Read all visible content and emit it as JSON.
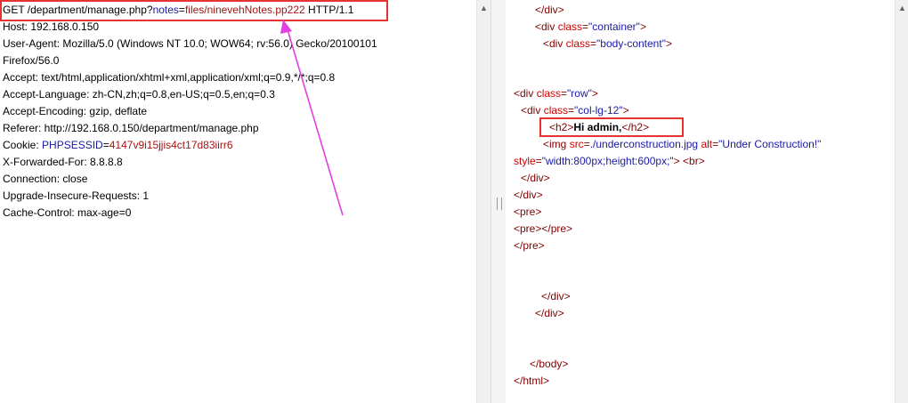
{
  "request": {
    "method": "GET",
    "path": "/department/manage.php?",
    "param_name": "notes",
    "eq": "=",
    "param_value": "files/ninevehNotes.pp222",
    "protocol": "HTTP/1.1",
    "host": "Host: 192.168.0.150",
    "ua_line1": "User-Agent: Mozilla/5.0 (Windows NT 10.0; WOW64; rv:56.0) Gecko/20100101",
    "ua_line2": "Firefox/56.0",
    "accept": "Accept: text/html,application/xhtml+xml,application/xml;q=0.9,*/*;q=0.8",
    "accept_language": "Accept-Language: zh-CN,zh;q=0.8,en-US;q=0.5,en;q=0.3",
    "accept_encoding": "Accept-Encoding: gzip, deflate",
    "referer": "Referer: http://192.168.0.150/department/manage.php",
    "cookie_label": "Cookie: ",
    "cookie_name": "PHPSESSID",
    "cookie_value": "4147v9i15jjis4ct17d83iirr6",
    "xff": "X-Forwarded-For: 8.8.8.8",
    "connection": "Connection: close",
    "upgrade": "Upgrade-Insecure-Requests: 1",
    "cache_control": "Cache-Control: max-age=0"
  },
  "response": {
    "l1": "</div>",
    "l2_open": "<div ",
    "l2_attr": "class",
    "l2_val": "\"container\"",
    "l2_close": ">",
    "l3_open": "<div ",
    "l3_attr": "class",
    "l3_val": "\"body-content\"",
    "l3_close": ">",
    "l4_open": "<div ",
    "l4_attr": "class",
    "l4_val": "\"row\"",
    "l4_close": ">",
    "l5_open": "<div ",
    "l5_attr": "class",
    "l5_val": "\"col-lg-12\"",
    "l5_close": ">",
    "h2_open": "<h2>",
    "h2_text": "Hi admin,",
    "h2_close": "</h2>",
    "img_open": "<img ",
    "img_src_attr": "src",
    "img_src_val": "./underconstruction.jpg",
    "img_alt_attr": "alt",
    "img_alt_val": "\"Under Construction!\"",
    "style_attr": "style",
    "style_val": "\"width:800px;height:600px;\"",
    "br": "> <br>",
    "div_close": "</div>",
    "pre_open": "<pre>",
    "pre_pair": "<pre></pre>",
    "pre_close": "</pre>",
    "body_close": "</body>",
    "html_close": "</html>"
  },
  "colors": {
    "highlight": "#e53333",
    "arrow": "#e040e0"
  },
  "icons": {
    "scroll_up": "triangle-up-icon",
    "scroll_down": "triangle-down-icon",
    "splitter_grip": "grip-icon"
  }
}
